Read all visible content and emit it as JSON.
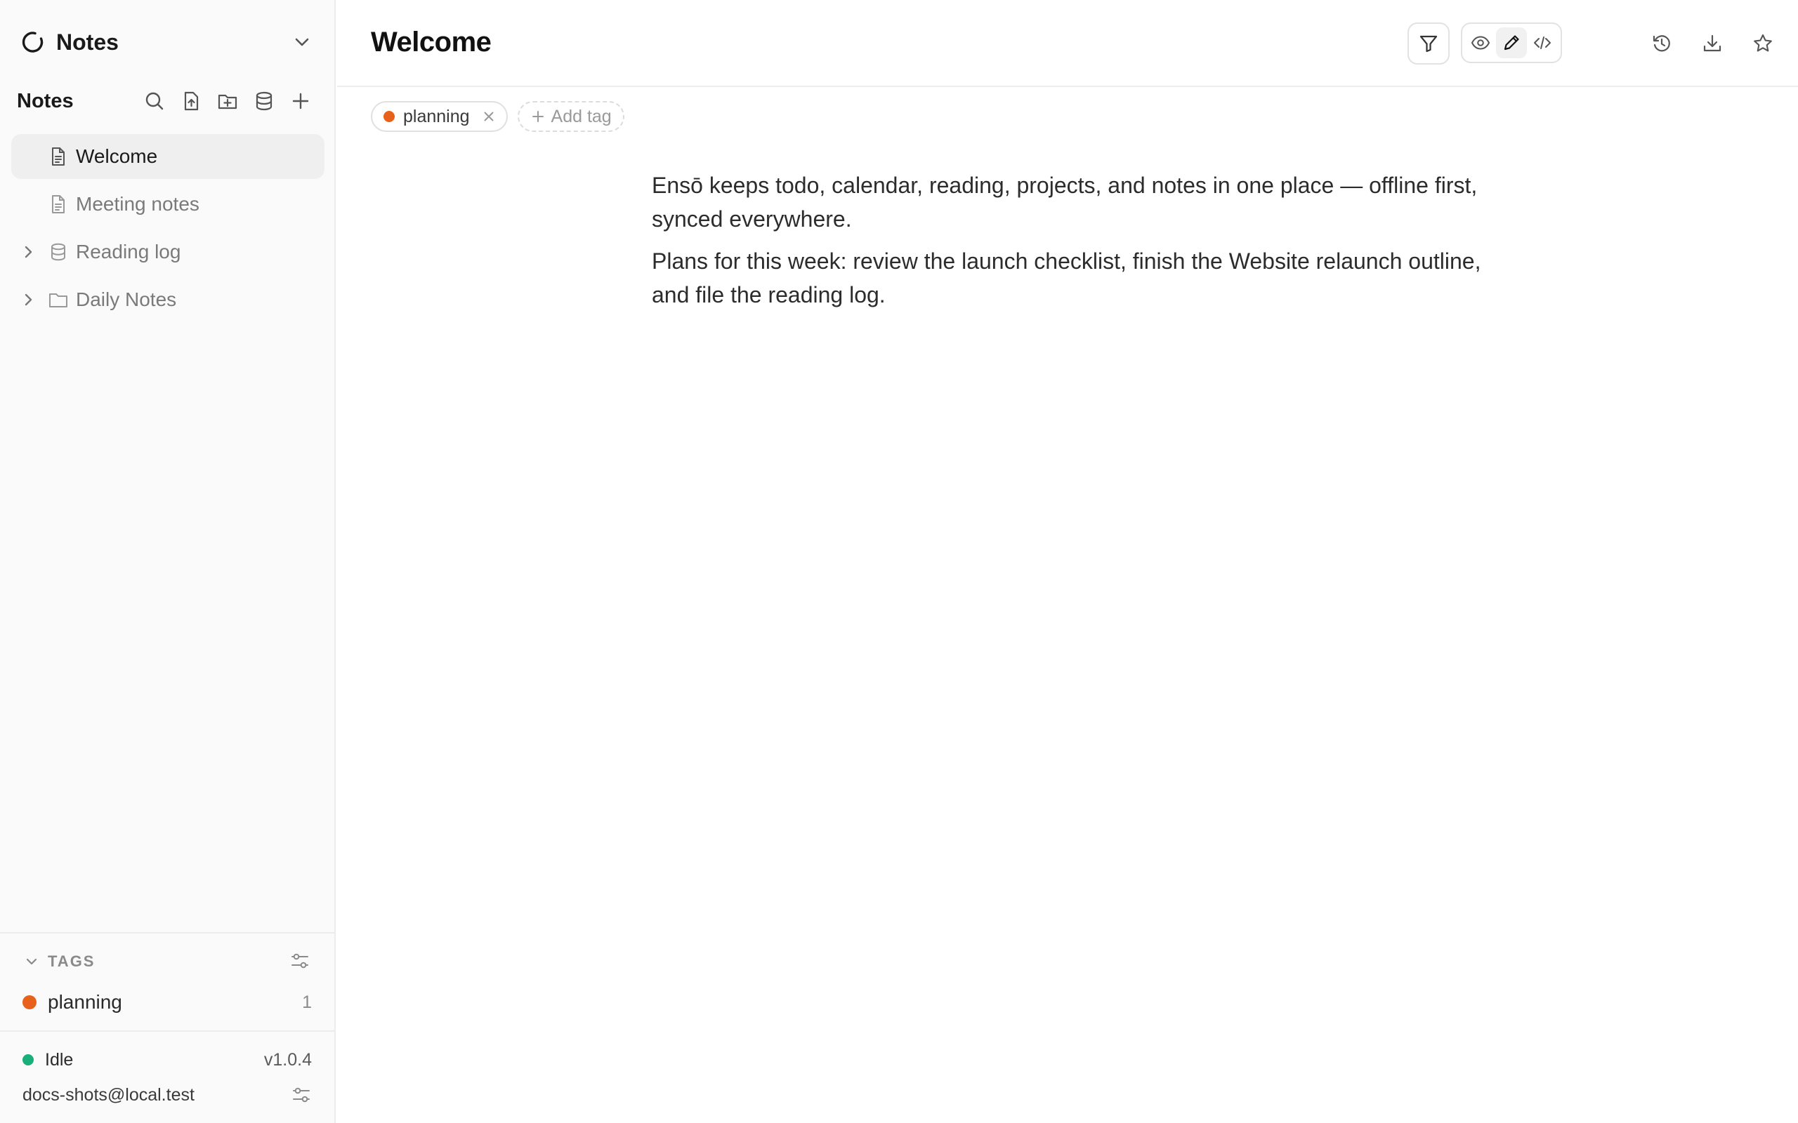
{
  "sidebar": {
    "workspace_title": "Notes",
    "notes_header": "Notes",
    "tree": [
      {
        "label": "Welcome",
        "icon": "document-icon",
        "active": true,
        "expandable": false
      },
      {
        "label": "Meeting notes",
        "icon": "document-icon",
        "active": false,
        "expandable": false
      },
      {
        "label": "Reading log",
        "icon": "database-icon",
        "active": false,
        "expandable": true
      },
      {
        "label": "Daily Notes",
        "icon": "folder-icon",
        "active": false,
        "expandable": true
      }
    ],
    "tags_heading": "TAGS",
    "tags": [
      {
        "name": "planning",
        "count": "1",
        "color": "#e8611a"
      }
    ],
    "status": {
      "label": "Idle",
      "color": "#1aae7a",
      "version": "v1.0.4"
    },
    "account_email": "docs-shots@local.test"
  },
  "main": {
    "title": "Welcome",
    "note_tags": [
      {
        "name": "planning",
        "color": "#e8611a"
      }
    ],
    "add_tag_label": "Add tag",
    "paragraphs": [
      "Ensō keeps todo, calendar, reading, projects, and notes in one place — offline first, synced everywhere.",
      "Plans for this week: review the launch checklist, finish the Website relaunch outline, and file the reading log."
    ]
  },
  "colors": {
    "accent_tag": "#e8611a",
    "status_ok": "#1aae7a",
    "sidebar_bg": "#fafafa",
    "active_item_bg": "#efefef"
  }
}
